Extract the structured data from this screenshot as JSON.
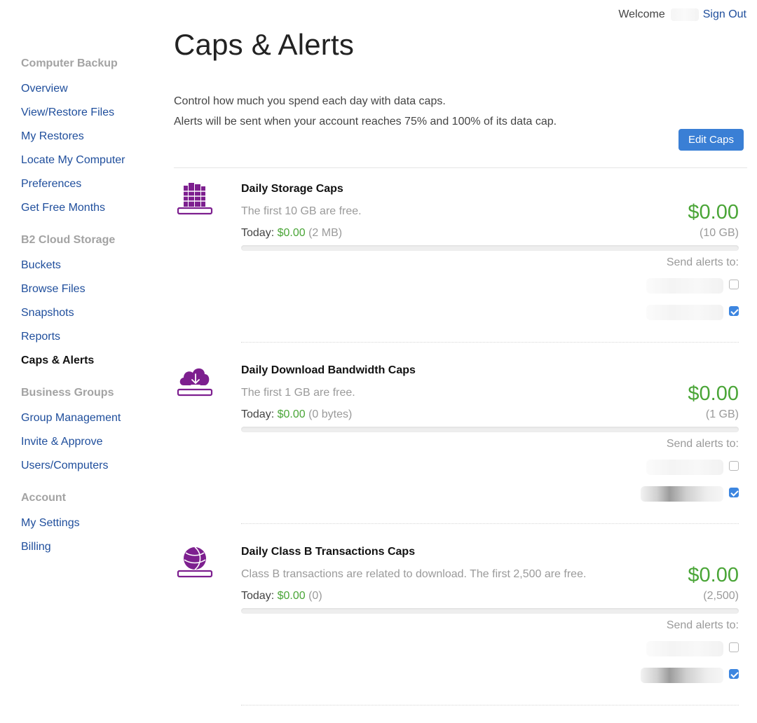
{
  "header": {
    "welcome": "Welcome",
    "sign_out": "Sign Out"
  },
  "sidebar": {
    "groups": [
      {
        "title": "Computer Backup",
        "items": [
          "Overview",
          "View/Restore Files",
          "My Restores",
          "Locate My Computer",
          "Preferences",
          "Get Free Months"
        ]
      },
      {
        "title": "B2 Cloud Storage",
        "items": [
          "Buckets",
          "Browse Files",
          "Snapshots",
          "Reports",
          "Caps & Alerts"
        ],
        "active": "Caps & Alerts"
      },
      {
        "title": "Business Groups",
        "items": [
          "Group Management",
          "Invite & Approve",
          "Users/Computers"
        ]
      },
      {
        "title": "Account",
        "items": [
          "My Settings",
          "Billing"
        ]
      }
    ]
  },
  "main": {
    "title": "Caps & Alerts",
    "intro_line1": "Control how much you spend each day with data caps.",
    "intro_line2": "Alerts will be sent when your account reaches 75% and 100% of its data cap.",
    "edit_button": "Edit Caps",
    "caps": [
      {
        "title": "Daily Storage Caps",
        "icon": "server-icon",
        "description": "The first 10 GB are free.",
        "amount": "$0.00",
        "today_label": "Today:",
        "today_value": "$0.00",
        "today_detail": "(2 MB)",
        "limit": "(10 GB)",
        "progress": 0,
        "send_label": "Send alerts to:",
        "recipients": [
          {
            "checked": false
          },
          {
            "checked": true
          }
        ]
      },
      {
        "title": "Daily Download Bandwidth Caps",
        "icon": "cloud-download-icon",
        "description": "The first 1 GB are free.",
        "amount": "$0.00",
        "today_label": "Today:",
        "today_value": "$0.00",
        "today_detail": "(0 bytes)",
        "limit": "(1 GB)",
        "progress": 0,
        "send_label": "Send alerts to:",
        "recipients": [
          {
            "checked": false
          },
          {
            "checked": true
          }
        ]
      },
      {
        "title": "Daily Class B Transactions Caps",
        "icon": "globe-icon",
        "description": "Class B transactions are related to download. The first 2,500 are free.",
        "amount": "$0.00",
        "today_label": "Today:",
        "today_value": "$0.00",
        "today_detail": "(0)",
        "limit": "(2,500)",
        "progress": 0,
        "send_label": "Send alerts to:",
        "recipients": [
          {
            "checked": false
          },
          {
            "checked": true
          }
        ]
      }
    ]
  },
  "colors": {
    "accent": "#3a7fd5",
    "link": "#1f4e9c",
    "money": "#4aa537",
    "icon": "#7d1f8f"
  }
}
